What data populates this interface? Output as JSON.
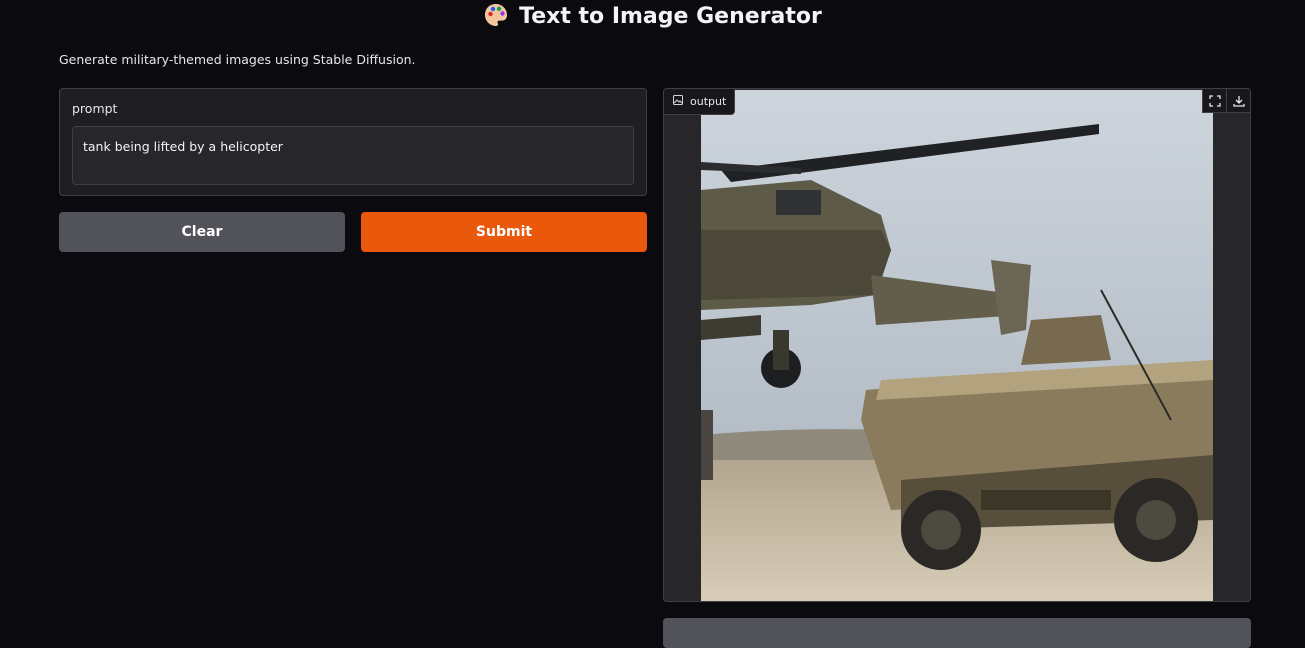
{
  "header": {
    "title": "Text to Image Generator",
    "description": "Generate military-themed images using Stable Diffusion."
  },
  "input": {
    "label": "prompt",
    "value": "tank being lifted by a helicopter"
  },
  "buttons": {
    "clear": "Clear",
    "submit": "Submit"
  },
  "output": {
    "label": "output",
    "icons": [
      "image-icon",
      "fullscreen-icon",
      "download-icon"
    ]
  },
  "colors": {
    "accent": "#ea580c",
    "secondary_button": "#52525b",
    "background": "#0b0b0f",
    "panel": "#1f1f23"
  }
}
